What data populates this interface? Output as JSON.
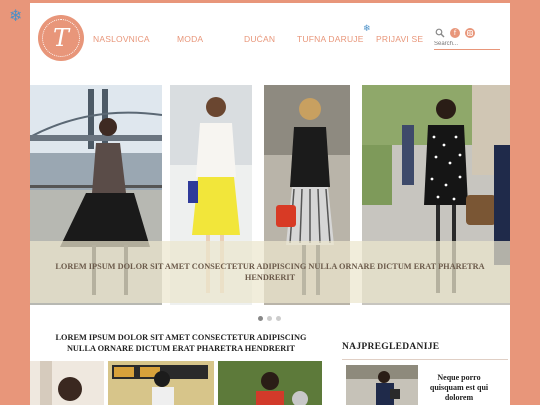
{
  "snowflake": "❄",
  "logo": {
    "letter": "T"
  },
  "nav": {
    "items": [
      {
        "label": "NASLOVNICA"
      },
      {
        "label": "MODA"
      },
      {
        "label": "DUĆAN"
      },
      {
        "label": "TUFNA DARUJE"
      },
      {
        "label": "PRIJAVI SE"
      }
    ]
  },
  "icons": [
    "search-icon",
    "facebook-icon",
    "instagram-icon"
  ],
  "search": {
    "placeholder": "Search..."
  },
  "slider": {
    "caption": "LOREM IPSUM DOLOR SIT AMET CONSECTETUR ADIPISCING NULLA ORNARE DICTUM ERAT PHARETRA HENDRERIT",
    "dots": 3,
    "active_dot": 0
  },
  "article": {
    "title": "LOREM IPSUM DOLOR SIT AMET CONSECTETUR ADIPISCING NULLA ORNARE DICTUM ERAT PHARETRA HENDRERIT"
  },
  "sidebar": {
    "title": "NAJPREGLEDANIJE",
    "item_text": "Neque porro quisquam est qui dolorem"
  },
  "colors": {
    "accent": "#e8967a",
    "background": "#e8967a",
    "snow": "#4a90c8"
  }
}
